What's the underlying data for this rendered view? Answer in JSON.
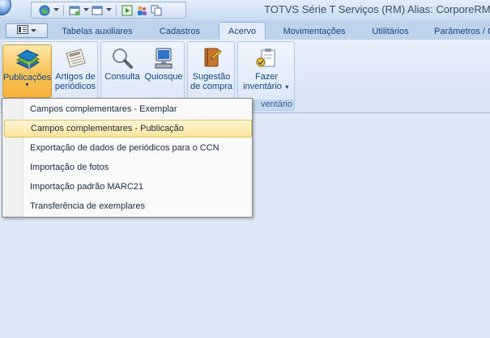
{
  "window": {
    "title": "TOTVS Série T Serviços (RM) Alias: CorporeRM"
  },
  "quick_access": {
    "icons": [
      "globe-icon",
      "new-window-icon",
      "window-icon",
      "run-icon",
      "users-icon",
      "copy-icon"
    ]
  },
  "tabs": [
    {
      "label": "Tabelas auxiliares",
      "active": false
    },
    {
      "label": "Cadastros",
      "active": false
    },
    {
      "label": "Acervo",
      "active": true
    },
    {
      "label": "Movimentações",
      "active": false
    },
    {
      "label": "Utilitários",
      "active": false
    },
    {
      "label": "Parâmetros / C",
      "active": false
    }
  ],
  "ribbon": {
    "publicacoes": {
      "line1": "Publicações",
      "caret": "▼"
    },
    "artigos": {
      "line1": "Artigos de",
      "line2": "periódicos"
    },
    "consulta": {
      "line1": "Consulta"
    },
    "quiosque": {
      "line1": "Quiosque"
    },
    "sugestao": {
      "line1": "Sugestão",
      "line2": "de compra"
    },
    "inventario": {
      "line1": "Fazer",
      "line2": "inventário",
      "caret": "▼"
    },
    "inventario_group_label": "ventário"
  },
  "dropdown": {
    "items": [
      {
        "label": "Campos complementares - Exemplar",
        "highlighted": false
      },
      {
        "label": "Campos complementares - Publicação",
        "highlighted": true
      },
      {
        "label": "Exportação de dados de periódicos para o CCN",
        "highlighted": false
      },
      {
        "label": "Importação de fotos",
        "highlighted": false
      },
      {
        "label": "Importação padrão MARC21",
        "highlighted": false
      },
      {
        "label": "Transferência de exemplares",
        "highlighted": false
      }
    ]
  },
  "colors": {
    "background": "#dde8f6",
    "accent": "#15428b",
    "highlight": "#ffe59a"
  }
}
